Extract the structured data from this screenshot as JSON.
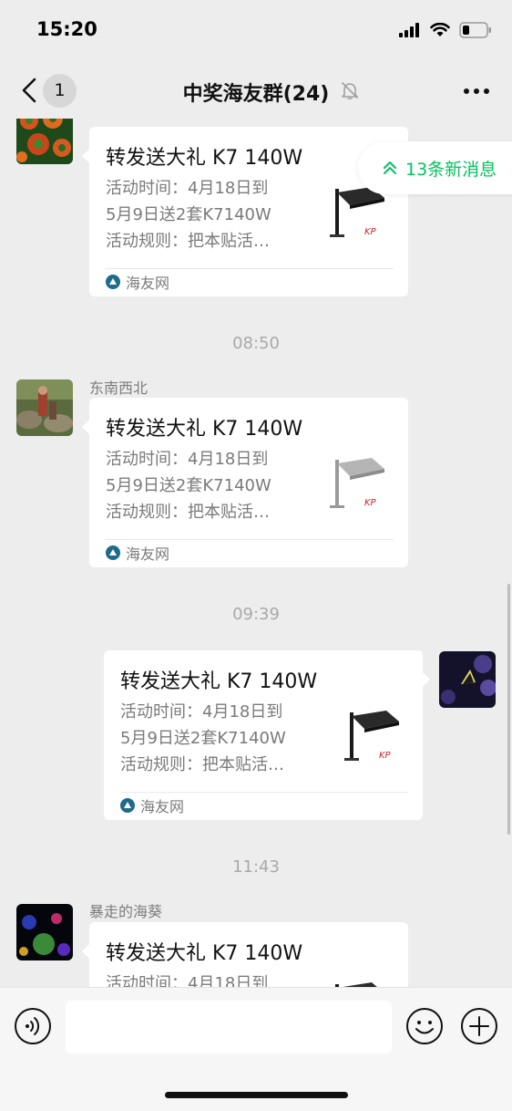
{
  "status": {
    "time": "15:20"
  },
  "nav": {
    "badge": "1",
    "title": "中奖海友群(24)"
  },
  "new_messages": {
    "label": "13条新消息"
  },
  "card": {
    "title": "转发送大礼 K7 140W",
    "desc_line1": "活动时间：4月18日到",
    "desc_line2": "5月9日送2套K7140W",
    "desc_line3": "活动规则：把本贴活…",
    "source": "海友网"
  },
  "messages": [
    {
      "sender": ""
    },
    {
      "time": "08:50",
      "sender": "东南西北"
    },
    {
      "time": "09:39",
      "sender": ""
    },
    {
      "time": "11:43",
      "sender": "暴走的海葵"
    }
  ],
  "input": {
    "placeholder": ""
  },
  "colors": {
    "accent": "#07c160",
    "background": "#ededed"
  }
}
